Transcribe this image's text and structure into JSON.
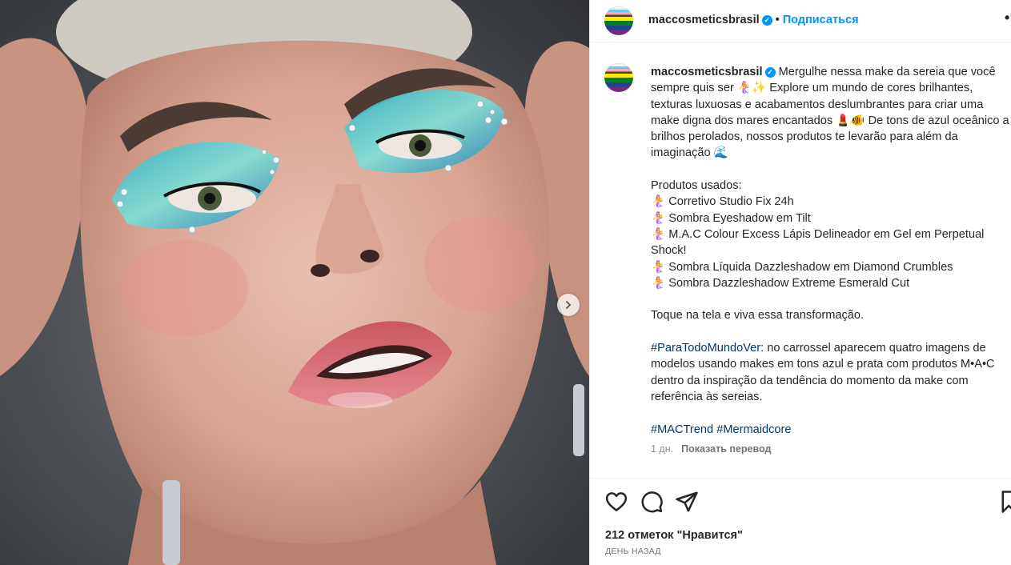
{
  "post": {
    "username": "maccosmeticsbrasil",
    "verified_mark": "✓",
    "separator": "•",
    "follow_label": "Подписаться",
    "more_label": "•",
    "caption_parts": [
      "Mergulhe nessa make da sereia que você sempre quis ser 🧜‍♀️✨ Explore um mundo de cores brilhantes, texturas luxuosas e acabamentos deslumbrantes para criar uma make digna dos mares encantados 💄🐠 De tons de azul oceânico a brilhos perolados, nossos produtos te levarão para além da imaginação 🌊",
      "Produtos usados:",
      "🧜‍♀️ Corretivo Studio Fix 24h",
      "🧜‍♀️ Sombra Eyeshadow em Tilt",
      "🧜‍♀️ M.A.C Colour Excess Lápis Delineador em Gel em Perpetual Shock!",
      "🧜‍♀️ Sombra Líquida Dazzleshadow em Diamond Crumbles",
      "🧜‍♀️ Sombra Dazzleshadow Extreme Esmerald Cut",
      "Toque na tela e viva essa transformação."
    ],
    "accessibility_hashtag": "#ParaTodoMundoVer",
    "accessibility_text": ": no carrossel aparecem quatro imagens de modelos usando makes em tons azul e prata com produtos M•A•C dentro da inspiração da tendência do momento da make com referência às sereias.",
    "hashtags": [
      "#MACTrend",
      "#Mermaidcore"
    ],
    "time": "1 дн.",
    "translate_label": "Показать перевод",
    "likes": "212 отметок \"Нравится\"",
    "ago": "ДЕНЬ НАЗАД"
  },
  "icons": {
    "next": "chevron-right-icon",
    "like": "heart-icon",
    "comment": "comment-icon",
    "share": "send-icon",
    "save": "bookmark-icon"
  },
  "colors": {
    "link": "#0095f6",
    "hashtag": "#00376b",
    "muted": "#8e8e8e"
  }
}
